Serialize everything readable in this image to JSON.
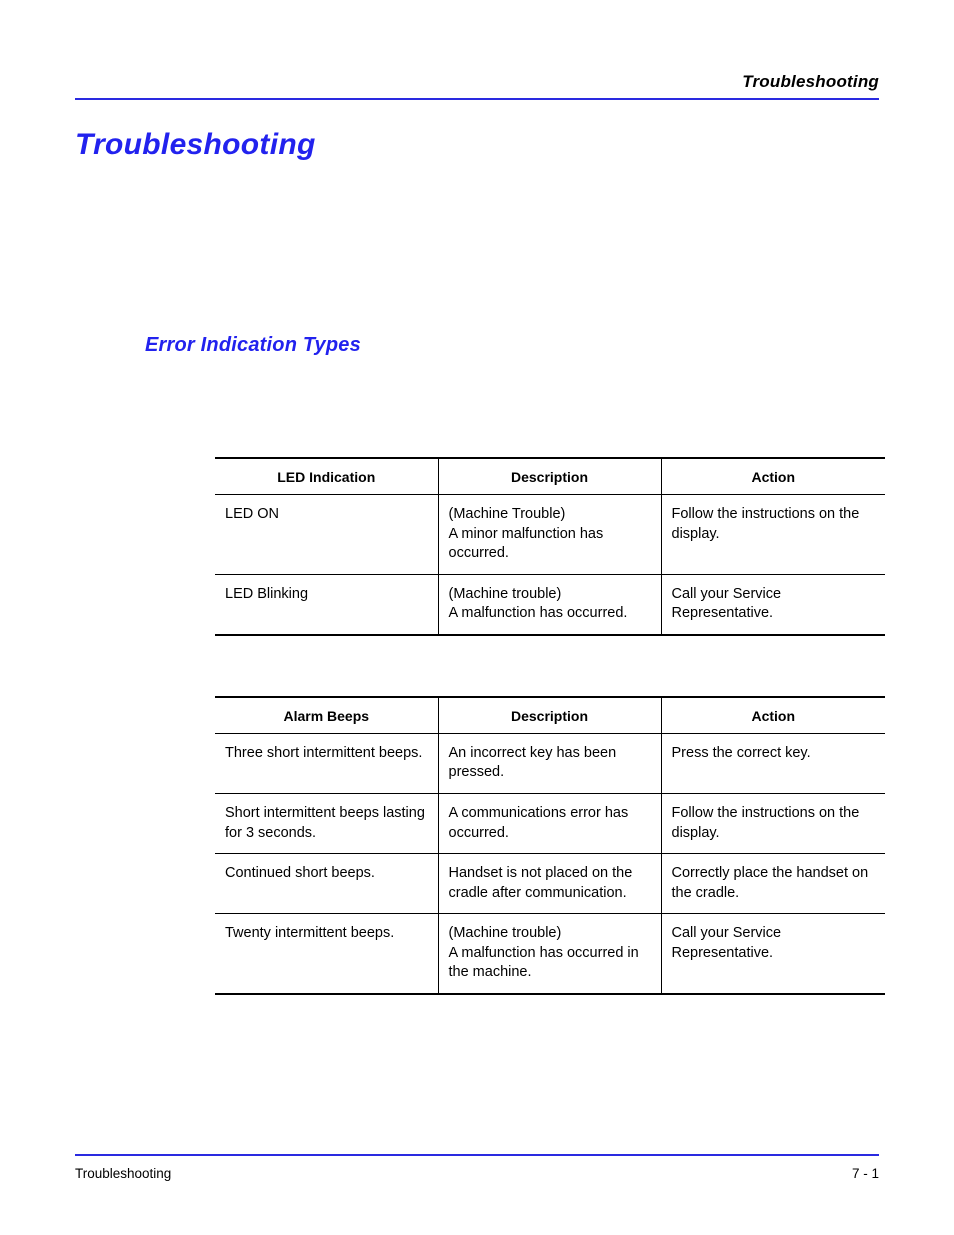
{
  "running_head": "Troubleshooting",
  "title": "Troubleshooting",
  "section_heading": "Error Indication Types",
  "table1": {
    "headers": [
      "LED Indication",
      "Description",
      "Action"
    ],
    "rows": [
      {
        "c0": "LED ON",
        "c1": "(Machine Trouble)\nA minor malfunction has occurred.",
        "c2": "Follow the instructions on the display."
      },
      {
        "c0": "LED Blinking",
        "c1": "(Machine trouble)\nA malfunction has occurred.",
        "c2": "Call your Service Representative."
      }
    ]
  },
  "table2": {
    "headers": [
      "Alarm Beeps",
      "Description",
      "Action"
    ],
    "rows": [
      {
        "c0": "Three short intermittent beeps.",
        "c1": "An incorrect key has been pressed.",
        "c2": "Press the correct key."
      },
      {
        "c0": "Short intermittent beeps lasting for 3 seconds.",
        "c1": "A communications error has occurred.",
        "c2": "Follow the instructions on the display."
      },
      {
        "c0": "Continued short beeps.",
        "c1": "Handset is not placed on the cradle after communication.",
        "c2": "Correctly place the handset on the cradle."
      },
      {
        "c0": "Twenty intermittent beeps.",
        "c1": "(Machine trouble)\nA malfunction has occurred in the machine.",
        "c2": "Call your Service Representative."
      }
    ]
  },
  "footer": {
    "left": "Troubleshooting",
    "right": "7 - 1"
  }
}
